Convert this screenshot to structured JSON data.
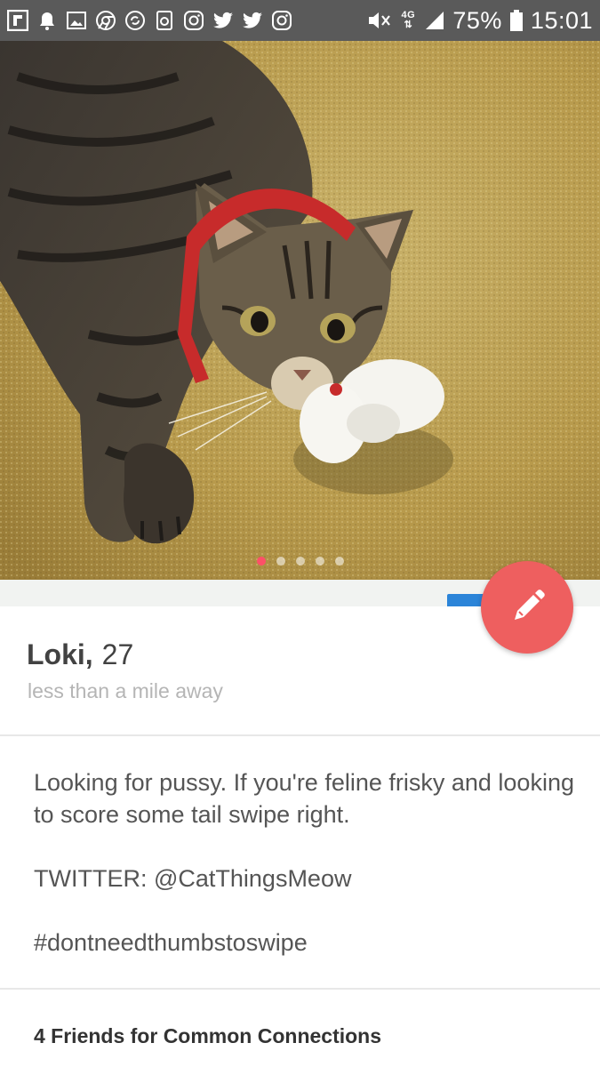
{
  "status_bar": {
    "icons": [
      "flipboard-icon",
      "notification-icon",
      "gallery-icon",
      "chrome-icon",
      "sync-icon",
      "recycle-icon",
      "instagram-icon",
      "twitter-icon",
      "twitter-icon",
      "instagram-icon",
      "mute-icon",
      "network-4g-icon",
      "signal-icon",
      "battery-icon"
    ],
    "network": "4G",
    "battery": "75%",
    "time": "15:01"
  },
  "photo": {
    "subject": "tabby cat with red collar holding white toy",
    "page_count": 5,
    "active_page": 1
  },
  "edit_button": {
    "icon": "pencil-icon",
    "color": "#ee5f5f"
  },
  "profile": {
    "name": "Loki",
    "age_separator": ",",
    "age": "27",
    "distance": "less than a mile away"
  },
  "bio": {
    "line1": "Looking for pussy. If you're feline frisky and looking to score some tail swipe right.",
    "line2": "TWITTER: @CatThingsMeow",
    "line3": "#dontneedthumbstoswipe"
  },
  "connections": {
    "label": "4 Friends for Common Connections"
  },
  "colors": {
    "accent": "#fd5068",
    "status_bar": "#5a5a5a",
    "blue_tab": "#2b84d8"
  }
}
